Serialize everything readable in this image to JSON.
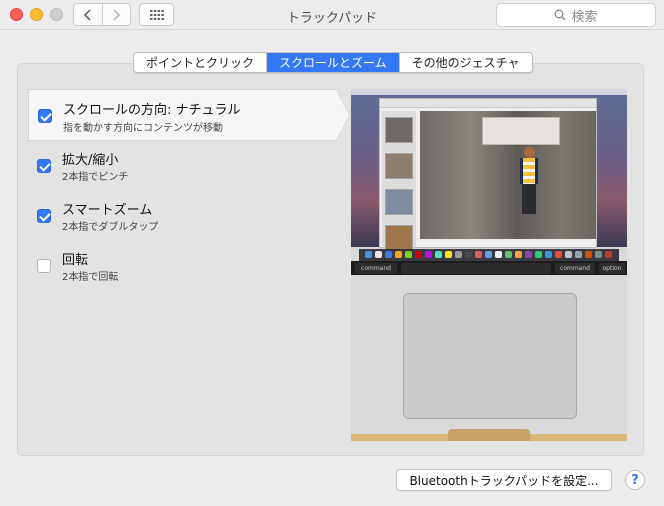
{
  "window": {
    "title": "トラックパッド"
  },
  "search": {
    "placeholder": "検索"
  },
  "tabs": [
    {
      "label": "ポイントとクリック",
      "active": false
    },
    {
      "label": "スクロールとズーム",
      "active": true
    },
    {
      "label": "その他のジェスチャ",
      "active": false
    }
  ],
  "options": [
    {
      "title": "スクロールの方向: ナチュラル",
      "subtitle": "指を動かす方向にコンテンツが移動",
      "checked": true,
      "selected": true
    },
    {
      "title": "拡大/縮小",
      "subtitle": "2本指でピンチ",
      "checked": true,
      "selected": false
    },
    {
      "title": "スマートズーム",
      "subtitle": "2本指でダブルタップ",
      "checked": true,
      "selected": false
    },
    {
      "title": "回転",
      "subtitle": "2本指で回転",
      "checked": false,
      "selected": false
    }
  ],
  "preview": {
    "keys": {
      "command_left": "command",
      "command_right": "command",
      "option_right": "option"
    }
  },
  "footer": {
    "bluetooth_button": "Bluetoothトラックパッドを設定...",
    "help_label": "?"
  },
  "colors": {
    "accent": "#3478f6",
    "window_bg": "#ececec",
    "panel_bg": "#e3e3e3"
  },
  "icons": {
    "back": "chevron-left-icon",
    "forward": "chevron-right-icon",
    "grid": "grid-icon",
    "search": "search-icon"
  }
}
